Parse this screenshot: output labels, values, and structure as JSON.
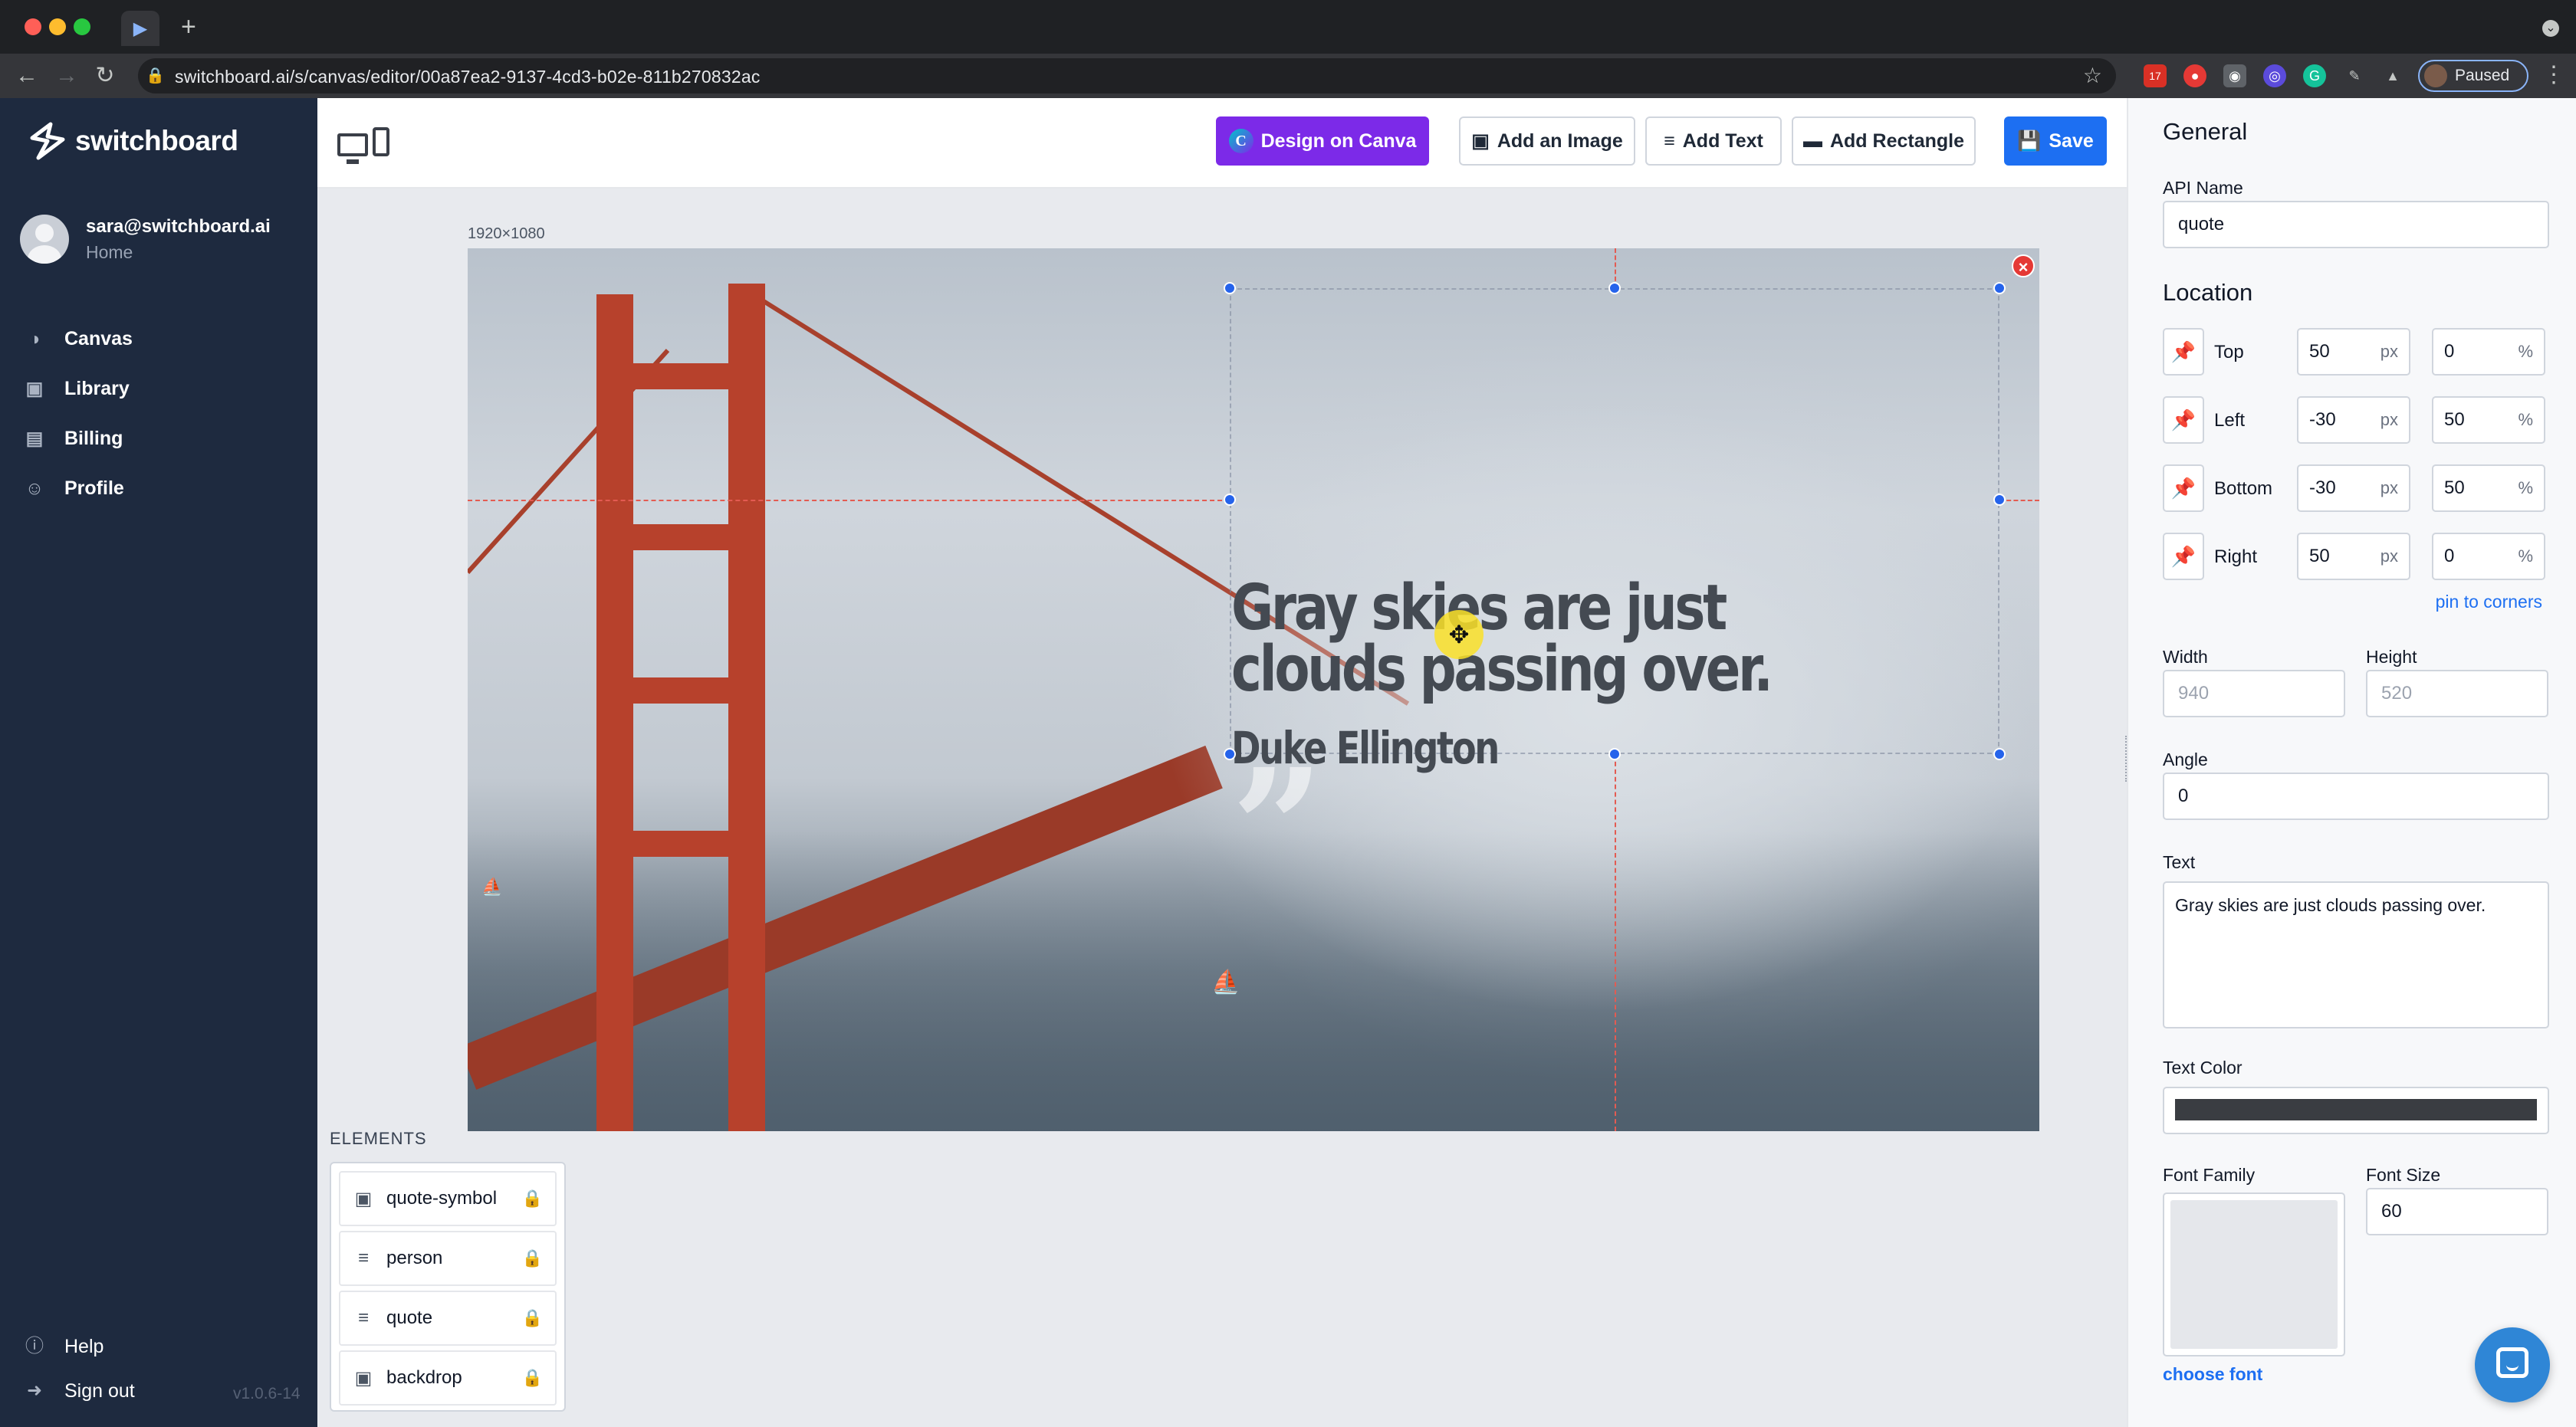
{
  "browser": {
    "url": "switchboard.ai/s/canvas/editor/00a87ea2-9137-4cd3-b02e-811b270832ac",
    "new_tab": "+",
    "profile_status": "Paused",
    "ext_badge": "17"
  },
  "sidebar": {
    "brand": "switchboard",
    "user_email": "sara@switchboard.ai",
    "user_role": "Home",
    "nav": [
      {
        "label": "Canvas",
        "icon": "palette-icon"
      },
      {
        "label": "Library",
        "icon": "images-icon"
      },
      {
        "label": "Billing",
        "icon": "credit-card-icon"
      },
      {
        "label": "Profile",
        "icon": "user-icon"
      }
    ],
    "help": "Help",
    "signout": "Sign out",
    "version": "v1.0.6-14"
  },
  "toolbar": {
    "canva": "Design on Canva",
    "canva_logo": "C",
    "add_image": "Add an Image",
    "add_text": "Add Text",
    "add_rect": "Add Rectangle",
    "save": "Save"
  },
  "canvas": {
    "dimensions": "1920×1080",
    "quote": "Gray skies are just clouds passing over.",
    "person": "Duke Ellington",
    "quote_symbol": "”"
  },
  "elements": {
    "title": "ELEMENTS",
    "items": [
      {
        "label": "quote-symbol",
        "icon": "image-icon"
      },
      {
        "label": "person",
        "icon": "text-icon"
      },
      {
        "label": "quote",
        "icon": "text-icon"
      },
      {
        "label": "backdrop",
        "icon": "image-icon"
      }
    ]
  },
  "panel": {
    "general": "General",
    "api_name_label": "API Name",
    "api_name": "quote",
    "location": "Location",
    "rows": [
      {
        "label": "Top",
        "px": "50",
        "pct": "0"
      },
      {
        "label": "Left",
        "px": "-30",
        "pct": "50"
      },
      {
        "label": "Bottom",
        "px": "-30",
        "pct": "50"
      },
      {
        "label": "Right",
        "px": "50",
        "pct": "0"
      }
    ],
    "unit_px": "px",
    "unit_pct": "%",
    "pin_corners": "pin to corners",
    "width_label": "Width",
    "width": "940",
    "height_label": "Height",
    "height": "520",
    "angle_label": "Angle",
    "angle": "0",
    "text_label": "Text",
    "text": "Gray skies are just clouds passing over.",
    "text_color_label": "Text Color",
    "text_color": "#3a3d42",
    "font_family_label": "Font Family",
    "font_size_label": "Font Size",
    "font_size": "60",
    "choose_font": "choose font"
  }
}
